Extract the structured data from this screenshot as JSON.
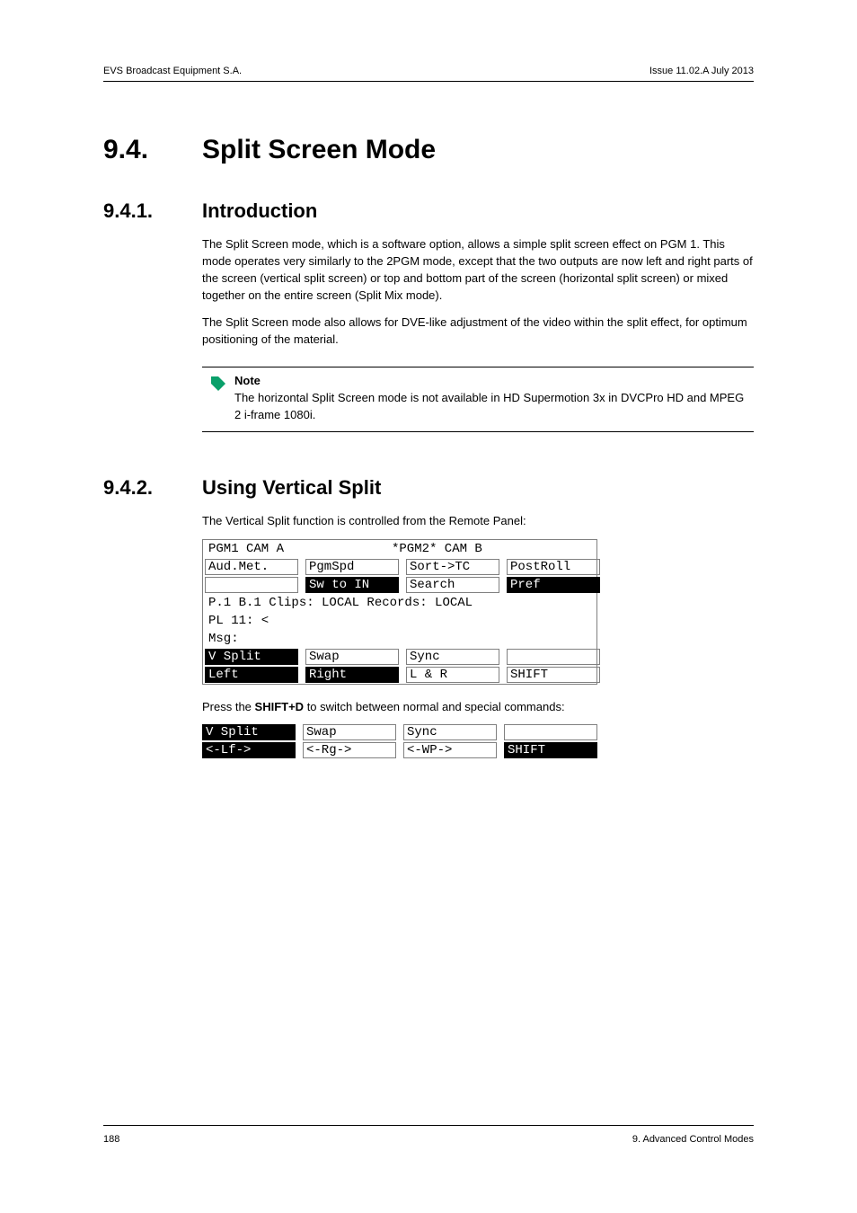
{
  "header": {
    "left": "EVS Broadcast Equipment S.A.",
    "right": "Issue 11.02.A  July 2013"
  },
  "h1": {
    "num": "9.4.",
    "title": "Split Screen Mode"
  },
  "s1": {
    "num": "9.4.1.",
    "title": "Introduction",
    "p1": "The Split Screen mode, which is a software option, allows a simple split screen effect on PGM 1. This mode operates very similarly to the 2PGM mode, except that the two outputs are now left and right parts of the screen (vertical split screen) or top and bottom part of the screen (horizontal split screen) or mixed together on the entire screen (Split Mix mode).",
    "p2": "The Split Screen mode also allows for DVE-like adjustment of the video within the split effect, for optimum positioning of the material.",
    "note_title": "Note",
    "note_body": "The horizontal Split Screen mode is not available in HD Supermotion 3x in DVCPro HD and MPEG 2 i-frame 1080i."
  },
  "s2": {
    "num": "9.4.2.",
    "title": "Using Vertical Split",
    "p1": "The Vertical Split function is controlled from the Remote Panel:",
    "p2_pre": "Press the ",
    "p2_bold": "SHIFT+D",
    "p2_post": " to switch between normal and special commands:"
  },
  "panel1": {
    "line1_left": "PGM1 CAM A",
    "line1_right": "*PGM2* CAM B",
    "r1c1": "Aud.Met.",
    "r1c2": "PgmSpd",
    "r1c3": "Sort->TC",
    "r1c4": "PostRoll",
    "r2c1": "",
    "r2c2": "Sw to IN",
    "r2c3": "Search",
    "r2c4": "Pref",
    "line4": "P.1 B.1 Clips: LOCAL Records: LOCAL",
    "line5": "PL 11: <",
    "line6": "Msg:",
    "r3c1": "V Split",
    "r3c2": "Swap",
    "r3c3": "Sync",
    "r3c4": "",
    "r4c1": "Left",
    "r4c2": "Right",
    "r4c3": "L & R",
    "r4c4": "SHIFT"
  },
  "panel2": {
    "r1c1": "V Split",
    "r1c2": "Swap",
    "r1c3": "Sync",
    "r1c4": "",
    "r2c1": "<-Lf->",
    "r2c2": "<-Rg->",
    "r2c3": "<-WP->",
    "r2c4": "SHIFT"
  },
  "footer": {
    "left": "188",
    "right": "9. Advanced Control Modes"
  }
}
